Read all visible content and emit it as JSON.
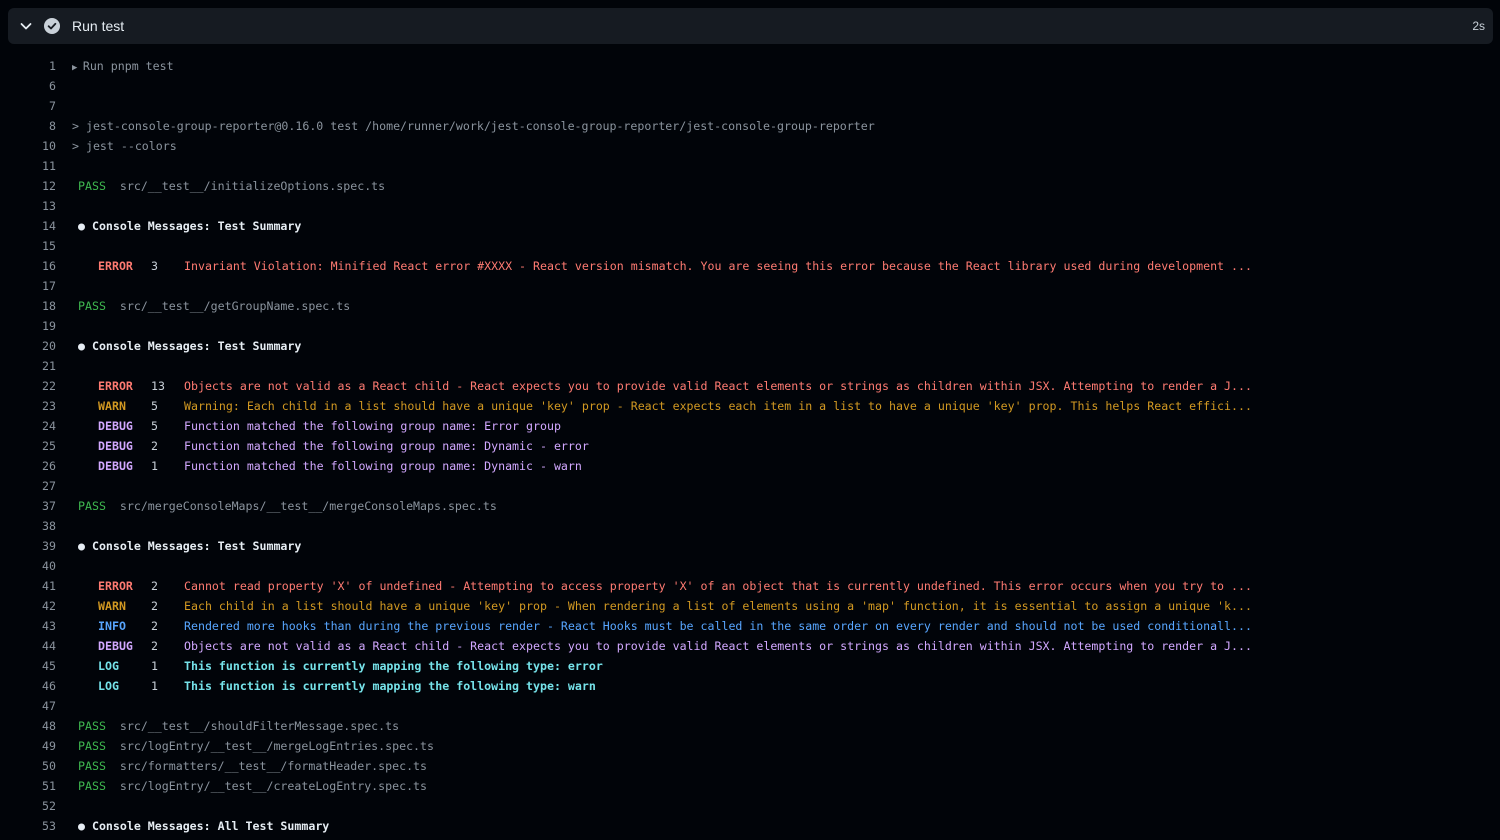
{
  "step": {
    "title": "Run test",
    "duration": "2s",
    "status": "success",
    "icons": {
      "collapse": "chevron-down-icon",
      "status": "check-circle-icon"
    }
  },
  "colors": {
    "pass": "#3fb950",
    "error": "#ff7b72",
    "warn": "#d29922",
    "debug": "#d2a8ff",
    "info": "#58a6ff",
    "log": "#76e3ea"
  },
  "lines": [
    {
      "n": "1",
      "kind": "group",
      "text": "Run pnpm test"
    },
    {
      "n": "6",
      "kind": "blank"
    },
    {
      "n": "7",
      "kind": "blank"
    },
    {
      "n": "8",
      "kind": "plain",
      "text": "> jest-console-group-reporter@0.16.0 test /home/runner/work/jest-console-group-reporter/jest-console-group-reporter"
    },
    {
      "n": "10",
      "kind": "plain",
      "text": "> jest --colors"
    },
    {
      "n": "11",
      "kind": "blank"
    },
    {
      "n": "12",
      "kind": "pass",
      "tag": "PASS",
      "text": "src/__test__/initializeOptions.spec.ts"
    },
    {
      "n": "13",
      "kind": "blank"
    },
    {
      "n": "14",
      "kind": "heading",
      "text": "● Console Messages: Test Summary"
    },
    {
      "n": "15",
      "kind": "blank"
    },
    {
      "n": "16",
      "kind": "entry",
      "level": "ERROR",
      "count": "3",
      "text": "Invariant Violation: Minified React error #XXXX - React version mismatch. You are seeing this error because the React library used during development ..."
    },
    {
      "n": "17",
      "kind": "blank"
    },
    {
      "n": "18",
      "kind": "pass",
      "tag": "PASS",
      "text": "src/__test__/getGroupName.spec.ts"
    },
    {
      "n": "19",
      "kind": "blank"
    },
    {
      "n": "20",
      "kind": "heading",
      "text": "● Console Messages: Test Summary"
    },
    {
      "n": "21",
      "kind": "blank"
    },
    {
      "n": "22",
      "kind": "entry",
      "level": "ERROR",
      "count": "13",
      "text": "Objects are not valid as a React child - React expects you to provide valid React elements or strings as children within JSX. Attempting to render a J..."
    },
    {
      "n": "23",
      "kind": "entry",
      "level": "WARN",
      "count": "5",
      "text": "Warning: Each child in a list should have a unique 'key' prop - React expects each item in a list to have a unique 'key' prop. This helps React effici..."
    },
    {
      "n": "24",
      "kind": "entry",
      "level": "DEBUG",
      "count": "5",
      "text": "Function matched the following group name: Error group"
    },
    {
      "n": "25",
      "kind": "entry",
      "level": "DEBUG",
      "count": "2",
      "text": "Function matched the following group name: Dynamic - error"
    },
    {
      "n": "26",
      "kind": "entry",
      "level": "DEBUG",
      "count": "1",
      "text": "Function matched the following group name: Dynamic - warn"
    },
    {
      "n": "27",
      "kind": "blank"
    },
    {
      "n": "37",
      "kind": "pass",
      "tag": "PASS",
      "text": "src/mergeConsoleMaps/__test__/mergeConsoleMaps.spec.ts"
    },
    {
      "n": "38",
      "kind": "blank"
    },
    {
      "n": "39",
      "kind": "heading",
      "text": "● Console Messages: Test Summary"
    },
    {
      "n": "40",
      "kind": "blank"
    },
    {
      "n": "41",
      "kind": "entry",
      "level": "ERROR",
      "count": "2",
      "text": "Cannot read property 'X' of undefined - Attempting to access property 'X' of an object that is currently undefined. This error occurs when you try to ..."
    },
    {
      "n": "42",
      "kind": "entry",
      "level": "WARN",
      "count": "2",
      "text": "Each child in a list should have a unique 'key' prop - When rendering a list of elements using a 'map' function, it is essential to assign a unique 'k..."
    },
    {
      "n": "43",
      "kind": "entry",
      "level": "INFO",
      "count": "2",
      "text": "Rendered more hooks than during the previous render - React Hooks must be called in the same order on every render and should not be used conditionall..."
    },
    {
      "n": "44",
      "kind": "entry",
      "level": "DEBUG",
      "count": "2",
      "text": "Objects are not valid as a React child - React expects you to provide valid React elements or strings as children within JSX. Attempting to render a J..."
    },
    {
      "n": "45",
      "kind": "entry",
      "level": "LOG",
      "count": "1",
      "text": "This function is currently mapping the following type: error"
    },
    {
      "n": "46",
      "kind": "entry",
      "level": "LOG",
      "count": "1",
      "text": "This function is currently mapping the following type: warn"
    },
    {
      "n": "47",
      "kind": "blank"
    },
    {
      "n": "48",
      "kind": "pass",
      "tag": "PASS",
      "text": "src/__test__/shouldFilterMessage.spec.ts"
    },
    {
      "n": "49",
      "kind": "pass",
      "tag": "PASS",
      "text": "src/logEntry/__test__/mergeLogEntries.spec.ts"
    },
    {
      "n": "50",
      "kind": "pass",
      "tag": "PASS",
      "text": "src/formatters/__test__/formatHeader.spec.ts"
    },
    {
      "n": "51",
      "kind": "pass",
      "tag": "PASS",
      "text": "src/logEntry/__test__/createLogEntry.spec.ts"
    },
    {
      "n": "52",
      "kind": "blank"
    },
    {
      "n": "53",
      "kind": "heading",
      "text": "● Console Messages: All Test Summary"
    }
  ]
}
